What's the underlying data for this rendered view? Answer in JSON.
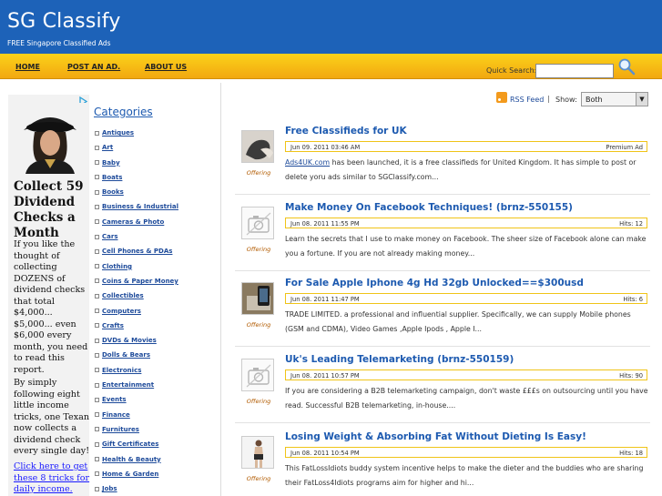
{
  "site": {
    "title": "SG Classify",
    "tagline": "FREE Singapore Classified Ads"
  },
  "nav": {
    "items": [
      "HOME",
      "POST AN AD.",
      "ABOUT US"
    ],
    "search_label": "Quick Search:"
  },
  "ad": {
    "headline": "Collect 59 Dividend Checks a Month",
    "paragraph1": "If you like the thought of collecting DOZENS of dividend checks that total $4,000... $5,000... even $6,000 every month, you need to read this report.",
    "paragraph2": "By simply following eight little income tricks, one Texan now collects a dividend check every single day!",
    "link": "Click here to get these 8 tricks for daily income."
  },
  "categories": {
    "title": "Categories",
    "items": [
      "Antiques",
      "Art",
      "Baby",
      "Boats",
      "Books",
      "Business & Industrial",
      "Cameras & Photo",
      "Cars",
      "Cell Phones & PDAs",
      "Clothing",
      "Coins & Paper Money",
      "Collectibles",
      "Computers",
      "Crafts",
      "DVDs & Movies",
      "Dolls & Bears",
      "Electronics",
      "Entertainment",
      "Events",
      "Finance",
      "Furnitures",
      "Gift Certificates",
      "Health & Beauty",
      "Home & Garden",
      "Jobs"
    ]
  },
  "controls": {
    "rss": "RSS Feed",
    "separator": "|",
    "show_label": "Show:",
    "show_value": "Both"
  },
  "listings": [
    {
      "title": "Free Classifieds for UK",
      "date": "Jun 09. 2011 03:46 AM",
      "right": "Premium Ad",
      "type": "Offering",
      "desc_link": "Ads4UK.com",
      "desc": " has been launched, it is a free classifieds for United Kingdom. It has simple to post or delete yoru ads similar to SGClassify.com..."
    },
    {
      "title": "Make Money On Facebook Techniques! (brnz-550155)",
      "date": "Jun 08. 2011 11:55 PM",
      "right": "Hits: 12",
      "type": "Offering",
      "desc": "Learn the secrets that I use to make money on Facebook. The sheer size of Facebook alone can make you a fortune. If you are not already making money..."
    },
    {
      "title": "For Sale Apple Iphone 4g Hd 32gb Unlocked==$300usd",
      "date": "Jun 08. 2011 11:47 PM",
      "right": "Hits: 6",
      "type": "Offering",
      "desc": "TRADE LIMITED. a professional and influential supplier. Specifically, we can supply Mobile phones (GSM and CDMA), Video Games ,Apple Ipods , Apple I..."
    },
    {
      "title": "Uk's Leading Telemarketing (brnz-550159)",
      "date": "Jun 08. 2011 10:57 PM",
      "right": "Hits: 90",
      "type": "Offering",
      "desc": "If you are considering a B2B telemarketing campaign, don't waste £££s on outsourcing until you have read. Successful B2B telemarketing, in-house...."
    },
    {
      "title": "Losing Weight & Absorbing Fat Without Dieting Is Easy!",
      "date": "Jun 08. 2011 10:54 PM",
      "right": "Hits: 18",
      "type": "Offering",
      "desc": "This FatLossIdiots buddy system incentive helps to make the dieter and the buddies who are sharing their FatLoss4Idiots programs aim for higher and hi..."
    }
  ]
}
